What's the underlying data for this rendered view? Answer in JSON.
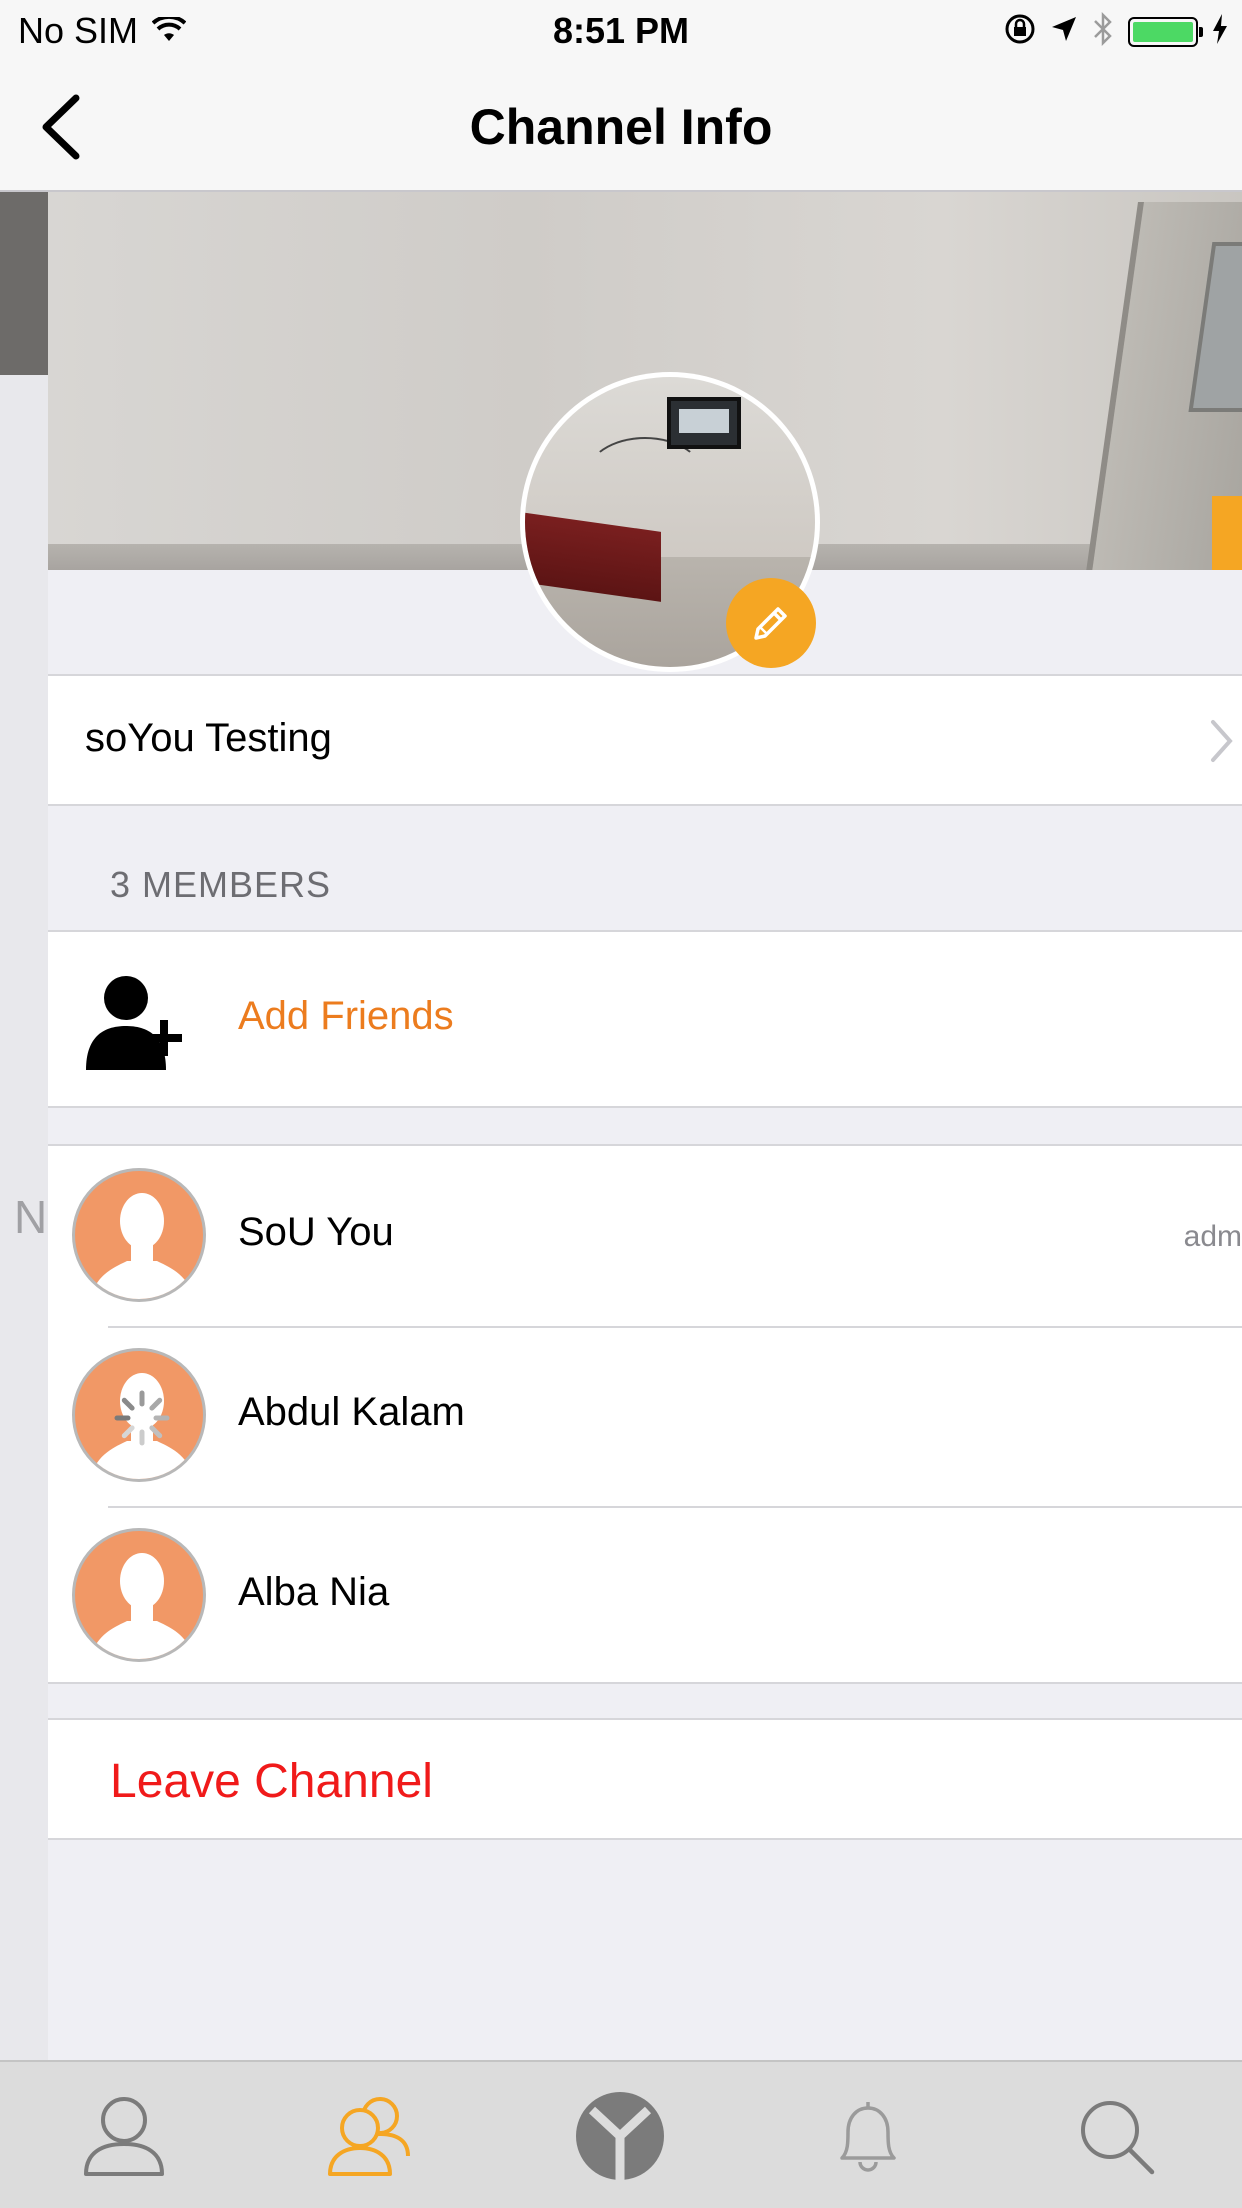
{
  "status_bar": {
    "carrier": "No SIM",
    "time": "8:51 PM",
    "icons": [
      "wifi-icon",
      "orientation-lock-icon",
      "location-icon",
      "bluetooth-icon",
      "battery-icon",
      "charging-icon"
    ]
  },
  "nav": {
    "title": "Channel Info",
    "back_icon": "chevron-left-icon"
  },
  "background_page": {
    "partial_letter": "N"
  },
  "channel": {
    "name": "soYou Testing",
    "edit_icon": "pencil-icon"
  },
  "members_section": {
    "header": "3 MEMBERS",
    "add_label": "Add Friends",
    "add_icon": "add-user-icon",
    "members": [
      {
        "name": "SoU You",
        "role": "adm"
      },
      {
        "name": "Abdul Kalam",
        "role": ""
      },
      {
        "name": "Alba Nia",
        "role": ""
      }
    ]
  },
  "actions": {
    "leave_label": "Leave Channel"
  },
  "colors": {
    "accent_orange": "#f5a623",
    "link_orange": "#ec7c1e",
    "destructive_red": "#f01a1a",
    "avatar_placeholder": "#f19866"
  },
  "tab_bar": {
    "tabs": [
      {
        "name": "profile",
        "icon": "person-icon",
        "active": false
      },
      {
        "name": "channels",
        "icon": "group-icon",
        "active": true
      },
      {
        "name": "home",
        "icon": "soyou-logo-icon",
        "active": false
      },
      {
        "name": "notifications",
        "icon": "bell-icon",
        "active": false
      },
      {
        "name": "search",
        "icon": "search-icon",
        "active": false
      }
    ]
  }
}
